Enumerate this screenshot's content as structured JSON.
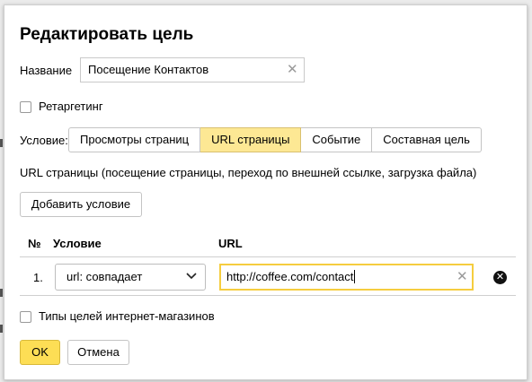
{
  "dialog": {
    "title": "Редактировать цель",
    "name_label": "Название",
    "name_value": "Посещение Контактов",
    "retargeting_label": "Ретаргетинг",
    "condition_label": "Условие:",
    "condition_tabs": [
      {
        "label": "Просмотры страниц",
        "active": false
      },
      {
        "label": "URL страницы",
        "active": true
      },
      {
        "label": "Событие",
        "active": false
      },
      {
        "label": "Составная цель",
        "active": false
      }
    ],
    "description": "URL страницы (посещение страницы, переход по внешней ссылке, загрузка файла)",
    "add_condition_label": "Добавить условие",
    "table": {
      "headers": {
        "num": "№",
        "condition": "Условие",
        "url": "URL"
      },
      "rows": [
        {
          "num": "1.",
          "condition": "url: совпадает",
          "url": "http://coffee.com/contact"
        }
      ]
    },
    "ecommerce_label": "Типы целей интернет-магазинов",
    "ok_label": "OK",
    "cancel_label": "Отмена"
  },
  "colors": {
    "active_tab": "#fde894",
    "ok_button": "#fdde55",
    "focus_border": "#f5cd3f"
  },
  "icons": [
    "clear-icon",
    "chevron-down-icon",
    "remove-condition-icon"
  ]
}
